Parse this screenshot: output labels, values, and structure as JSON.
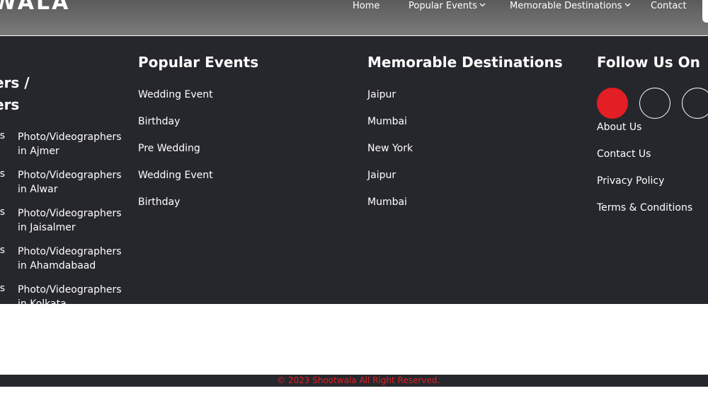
{
  "brand": {
    "logo_text": "WALA"
  },
  "nav": {
    "home": "Home",
    "popular_events": "Popular Events",
    "memorable_destinations": "Memorable Destinations",
    "contact": "Contact"
  },
  "footer": {
    "left_col": {
      "title_line1": "ers /",
      "title_line2": "ers",
      "cut_label": "rs",
      "items": [
        {
          "line1": "Photo/Videographers",
          "line2": "in Ajmer"
        },
        {
          "line1": "Photo/Videographers",
          "line2": "in Alwar"
        },
        {
          "line1": "Photo/Videographers",
          "line2": "in Jaisalmer"
        },
        {
          "line1": "Photo/Videographers",
          "line2": "in Ahamdabaad"
        },
        {
          "line1": "Photo/Videographers",
          "line2": "in Kolkata"
        }
      ]
    },
    "events": {
      "title": "Popular Events",
      "items": [
        "Wedding Event",
        "Birthday",
        "Pre Wedding",
        "Wedding Event",
        "Birthday"
      ]
    },
    "destinations": {
      "title": "Memorable Destinations",
      "items": [
        "Jaipur",
        "Mumbai",
        "New York",
        "Jaipur",
        "Mumbai"
      ]
    },
    "follow": {
      "title": "Follow Us On",
      "social_icons": [
        "social-icon-1",
        "social-icon-2",
        "social-icon-3"
      ],
      "links": [
        "About Us",
        "Contact Us",
        "Privacy Policy",
        "Terms & Conditions"
      ]
    },
    "copyright": "© 2023 Shootwala All Right Reserved.",
    "colors": {
      "accent": "#e31e24",
      "panel": "#26272c"
    }
  }
}
